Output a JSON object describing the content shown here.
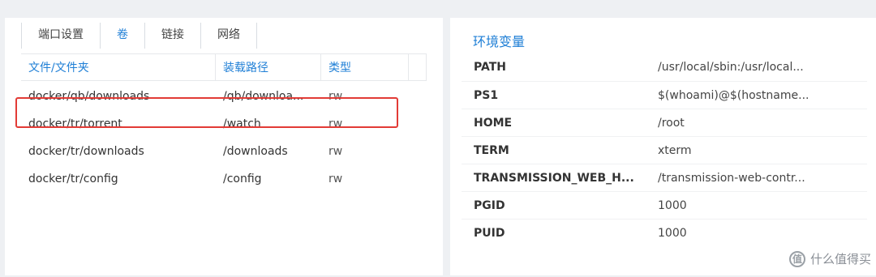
{
  "tabs": [
    {
      "label": "端口设置",
      "active": false
    },
    {
      "label": "卷",
      "active": true
    },
    {
      "label": "链接",
      "active": false
    },
    {
      "label": "网络",
      "active": false
    }
  ],
  "volumes": {
    "headers": [
      "文件/文件夹",
      "装载路径",
      "类型"
    ],
    "rows": [
      {
        "folder": "docker/qb/downloads",
        "mount": "/qb/downloa...",
        "type": "rw",
        "highlighted": true
      },
      {
        "folder": "docker/tr/torrent",
        "mount": "/watch",
        "type": "rw",
        "highlighted": false
      },
      {
        "folder": "docker/tr/downloads",
        "mount": "/downloads",
        "type": "rw",
        "highlighted": false
      },
      {
        "folder": "docker/tr/config",
        "mount": "/config",
        "type": "rw",
        "highlighted": false
      }
    ]
  },
  "env": {
    "title": "环境变量",
    "rows": [
      {
        "key": "PATH",
        "value": "/usr/local/sbin:/usr/local..."
      },
      {
        "key": "PS1",
        "value": "$(whoami)@$(hostname..."
      },
      {
        "key": "HOME",
        "value": "/root"
      },
      {
        "key": "TERM",
        "value": "xterm"
      },
      {
        "key": "TRANSMISSION_WEB_H...",
        "value": "/transmission-web-contr..."
      },
      {
        "key": "PGID",
        "value": "1000"
      },
      {
        "key": "PUID",
        "value": "1000"
      }
    ]
  },
  "watermark": {
    "icon_char": "值",
    "text": "什么值得买"
  },
  "colors": {
    "accent": "#1f7fd6",
    "highlight": "#e23b36"
  }
}
